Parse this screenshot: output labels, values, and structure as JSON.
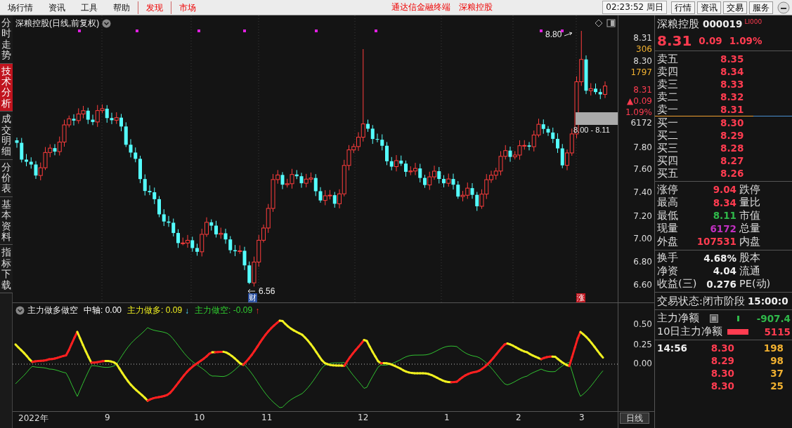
{
  "menu": [
    {
      "label": "场行情",
      "kind": "normal"
    },
    {
      "label": "资讯",
      "kind": "normal"
    },
    {
      "label": "工具",
      "kind": "normal"
    },
    {
      "label": "帮助",
      "kind": "normal"
    },
    {
      "label": "发现",
      "kind": "highlight"
    },
    {
      "label": "市场",
      "kind": "highlight"
    }
  ],
  "title_texts": [
    "通达信金融终端",
    "深粮控股"
  ],
  "clock": "02:23:52 周日",
  "top_buttons": [
    "行情",
    "资讯",
    "交易",
    "服务"
  ],
  "side_tabs": [
    {
      "label": "分时走势",
      "selected": false
    },
    {
      "label": "技术分析",
      "selected": true
    },
    {
      "label": "成交明细",
      "selected": false
    },
    {
      "label": "分价表",
      "selected": false
    },
    {
      "label": "基本资料",
      "selected": false
    },
    {
      "label": "指标下载",
      "selected": false
    }
  ],
  "chart": {
    "title": "深粮控股(日线,前复权)",
    "high_label": "8.80",
    "low_label": "6.56",
    "range_label": "8.00 - 8.11",
    "tags": [
      {
        "text": "财",
        "kind": "finance"
      },
      {
        "text": "涨",
        "kind": "limit"
      }
    ],
    "price_axis": [
      {
        "text": "8.31",
        "kind": "price"
      },
      {
        "text": "306",
        "kind": "volume"
      },
      {
        "text": "8.30",
        "kind": "price"
      },
      {
        "text": "1797",
        "kind": "volume"
      },
      {
        "text": "8.31",
        "kind": "up"
      },
      {
        "text": "▲0.09",
        "kind": "up"
      },
      {
        "text": "1.09%",
        "kind": "up"
      },
      {
        "text": "6172",
        "kind": "price"
      },
      {
        "text": "7.80",
        "kind": "price"
      },
      {
        "text": "7.60",
        "kind": "price"
      },
      {
        "text": "7.40",
        "kind": "price"
      },
      {
        "text": "7.20",
        "kind": "price"
      },
      {
        "text": "7.00",
        "kind": "price"
      },
      {
        "text": "6.80",
        "kind": "price"
      },
      {
        "text": "6.60",
        "kind": "price"
      }
    ]
  },
  "indicator": {
    "name": "主力做多做空",
    "params": [
      {
        "label": "中轴:",
        "value": "0.00",
        "kind": "axis"
      },
      {
        "label": "主力做多:",
        "value": "0.09",
        "arrow": "↓",
        "kind": "long"
      },
      {
        "label": "主力做空:",
        "value": "-0.09",
        "arrow": "↑",
        "kind": "short"
      }
    ],
    "axis": [
      "0.50",
      "0.25",
      "0.00"
    ]
  },
  "x_axis": [
    "2022年",
    "9",
    "10",
    "11",
    "12",
    "1",
    "2",
    "3"
  ],
  "period": "日线",
  "quote": {
    "name": "深粮控股",
    "code": "000019",
    "tag": "LI000",
    "price": "8.31",
    "change": "0.09",
    "percent": "1.09%",
    "sells": [
      {
        "label": "卖五",
        "price": "8.35"
      },
      {
        "label": "卖四",
        "price": "8.34"
      },
      {
        "label": "卖三",
        "price": "8.33"
      },
      {
        "label": "卖二",
        "price": "8.32"
      },
      {
        "label": "卖一",
        "price": "8.31"
      }
    ],
    "buys": [
      {
        "label": "买一",
        "price": "8.30"
      },
      {
        "label": "买二",
        "price": "8.29"
      },
      {
        "label": "买三",
        "price": "8.28"
      },
      {
        "label": "买四",
        "price": "8.27"
      },
      {
        "label": "买五",
        "price": "8.26"
      }
    ],
    "stats": [
      {
        "label": "涨停",
        "value": "9.04",
        "color": "#ff3c50",
        "label2": "跌停"
      },
      {
        "label": "最高",
        "value": "8.34",
        "color": "#ff3c50",
        "label2": "量比"
      },
      {
        "label": "最低",
        "value": "8.11",
        "color": "#2fb84a",
        "label2": "市值"
      },
      {
        "label": "现量",
        "value": "6172",
        "color": "#c030c0",
        "label2": "总量"
      },
      {
        "label": "外盘",
        "value": "107531",
        "color": "#ff3c50",
        "label2": "内盘"
      }
    ],
    "stats2": [
      {
        "label": "换手",
        "value": "4.68%",
        "label2": "股本"
      },
      {
        "label": "净资",
        "value": "4.04",
        "label2": "流通"
      },
      {
        "label": "收益(三)",
        "value": "0.276",
        "label2": "PE(动)"
      }
    ],
    "status_label": "交易状态:",
    "status_value": "闭市阶段",
    "status_time": "15:00:0",
    "flows": [
      {
        "label": "主力净额",
        "value": "-907.4",
        "color": "#2fb84a"
      },
      {
        "label": "10日主力净额",
        "value": "5115",
        "color": "#ff3c50"
      }
    ],
    "ticks": [
      {
        "time": "14:56",
        "price": "8.30",
        "volume": "198"
      },
      {
        "price": "8.29",
        "volume": "98"
      },
      {
        "price": "8.30",
        "volume": "37"
      },
      {
        "price": "8.30",
        "volume": "25"
      }
    ]
  }
}
